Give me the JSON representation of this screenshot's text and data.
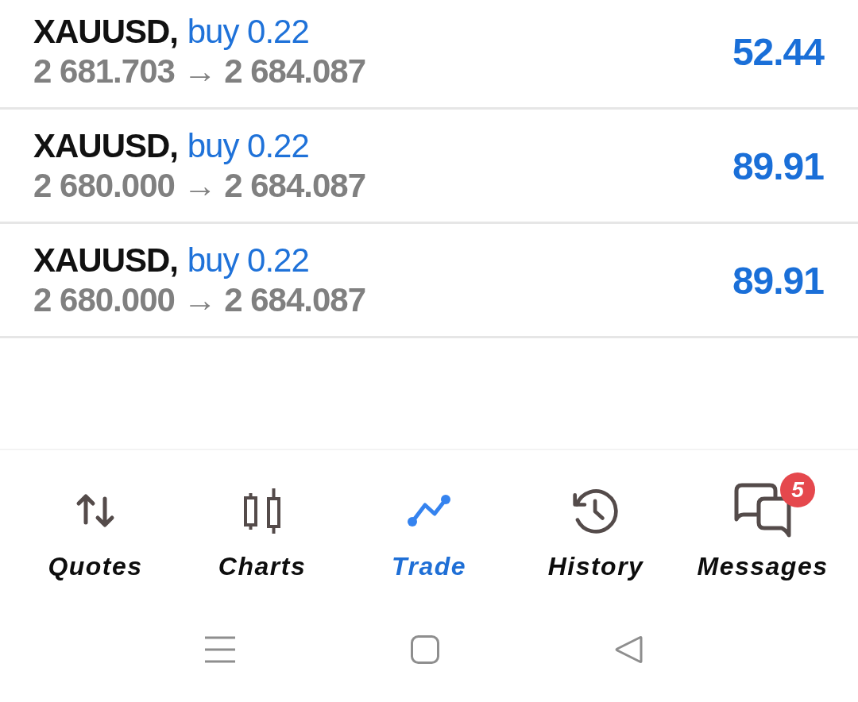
{
  "positions": [
    {
      "symbol": "XAUUSD,",
      "order": "buy 0.22",
      "prices": "2 681.703 → 2 684.087",
      "profit": "52.44"
    },
    {
      "symbol": "XAUUSD,",
      "order": "buy 0.22",
      "prices": "2 680.000 → 2 684.087",
      "profit": "89.91"
    },
    {
      "symbol": "XAUUSD,",
      "order": "buy 0.22",
      "prices": "2 680.000 → 2 684.087",
      "profit": "89.91"
    }
  ],
  "bottom_nav": {
    "tabs": [
      {
        "label": "Quotes",
        "selected": false
      },
      {
        "label": "Charts",
        "selected": false
      },
      {
        "label": "Trade",
        "selected": true
      },
      {
        "label": "History",
        "selected": false
      },
      {
        "label": "Messages",
        "selected": false,
        "badge": "5"
      }
    ]
  }
}
